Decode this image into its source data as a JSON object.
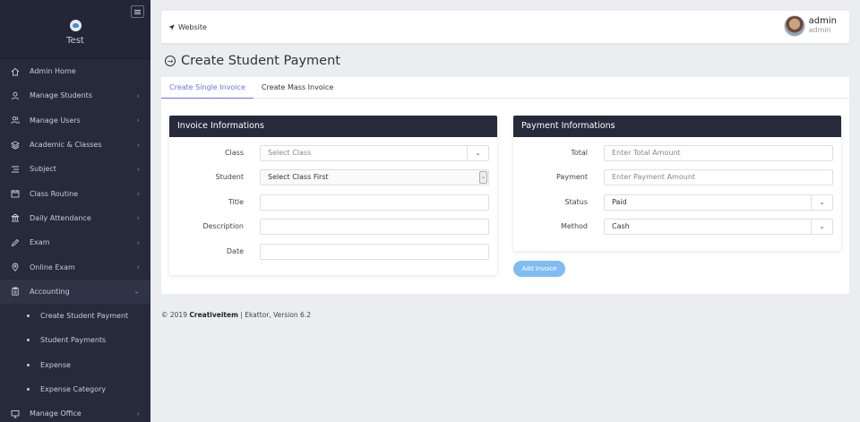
{
  "sidebar": {
    "brand": "Test",
    "items": [
      {
        "label": "Admin Home",
        "icon": "home-icon",
        "chevron": false
      },
      {
        "label": "Manage Students",
        "icon": "user-icon",
        "chevron": true
      },
      {
        "label": "Manage Users",
        "icon": "users-icon",
        "chevron": true
      },
      {
        "label": "Academic & Classes",
        "icon": "layers-icon",
        "chevron": true
      },
      {
        "label": "Subject",
        "icon": "list-icon",
        "chevron": true
      },
      {
        "label": "Class Routine",
        "icon": "calendar-icon",
        "chevron": true
      },
      {
        "label": "Daily Attendance",
        "icon": "building-icon",
        "chevron": true
      },
      {
        "label": "Exam",
        "icon": "pencil-icon",
        "chevron": true
      },
      {
        "label": "Online Exam",
        "icon": "location-icon",
        "chevron": true
      },
      {
        "label": "Accounting",
        "icon": "clipboard-icon",
        "chevron": true
      }
    ],
    "accounting_sub": [
      {
        "label": "Create Student Payment"
      },
      {
        "label": "Student Payments"
      },
      {
        "label": "Expense"
      },
      {
        "label": "Expense Category"
      }
    ],
    "last_item": {
      "label": "Manage Office",
      "icon": "monitor-icon"
    }
  },
  "topbar": {
    "website_label": "Website",
    "user_name": "admin",
    "user_role": "admin"
  },
  "page": {
    "title": "Create Student Payment"
  },
  "tabs": [
    {
      "label": "Create Single Invoice",
      "active": true
    },
    {
      "label": "Create Mass Invoice",
      "active": false
    }
  ],
  "invoice": {
    "heading": "Invoice Informations",
    "class_label": "Class",
    "class_value": "Select Class",
    "student_label": "Student",
    "student_value": "Select Class First",
    "title_label": "Title",
    "description_label": "Description",
    "date_label": "Date"
  },
  "payment": {
    "heading": "Payment Informations",
    "total_label": "Total",
    "total_placeholder": "Enter Total Amount",
    "payment_label": "Payment",
    "payment_placeholder": "Enter Payment Amount",
    "status_label": "Status",
    "status_value": "Paid",
    "method_label": "Method",
    "method_value": "Cash"
  },
  "add_invoice_label": "Add Invoice",
  "footer": {
    "prefix": "© 2019",
    "company": "Creativeitem",
    "suffix": "| Ekattor, Version 6.2"
  }
}
